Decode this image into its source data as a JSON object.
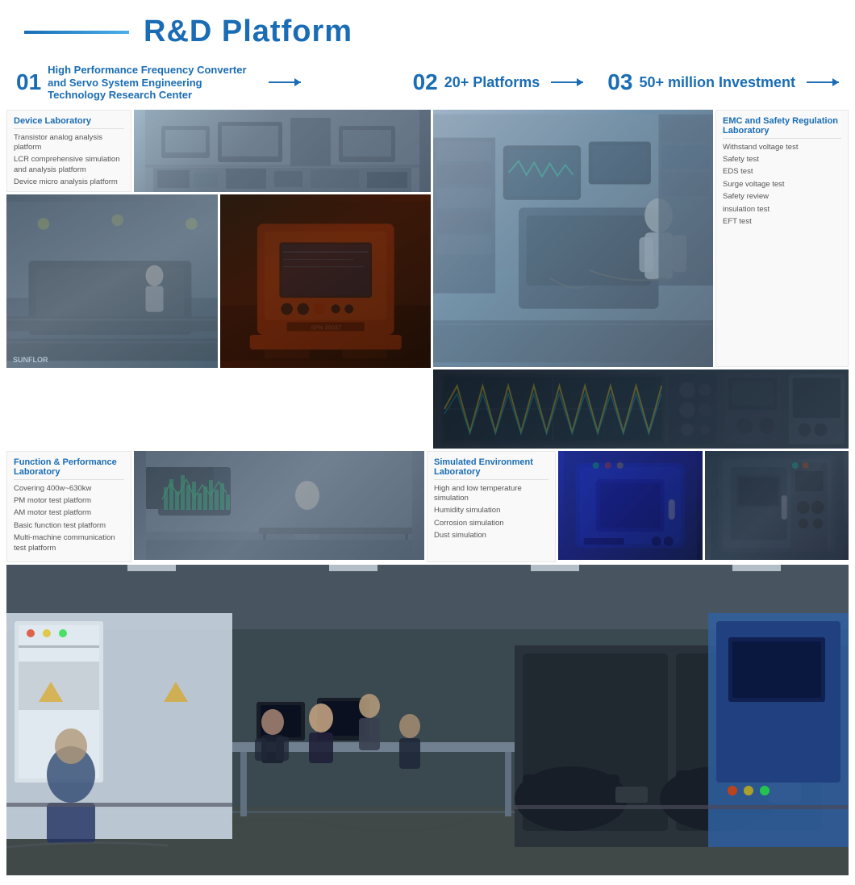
{
  "header": {
    "title": "R&D Platform",
    "line_decoration": true
  },
  "sections": [
    {
      "number": "01",
      "label": "High Performance Frequency Converter and Servo System Engineering Technology Research Center"
    },
    {
      "number": "02",
      "label": "20+ Platforms"
    },
    {
      "number": "03",
      "label": "50+ million Investment"
    }
  ],
  "device_lab": {
    "title": "Device Laboratory",
    "items": [
      "Transistor analog analysis platform",
      "LCR comprehensive simulation and analysis platform",
      "Device micro analysis platform"
    ]
  },
  "emc_lab": {
    "title": "EMC and Safety Regulation Laboratory",
    "items": [
      "Withstand voltage test",
      "Safety test",
      "EDS test",
      "Surge voltage test",
      "Safety review",
      "insulation test",
      "EFT test"
    ]
  },
  "function_lab": {
    "title": "Function & Performance Laboratory",
    "items": [
      "Covering 400w~630kw",
      "PM motor test platform",
      "AM motor test platform",
      "Basic function test platform",
      "Multi-machine communication test platform"
    ]
  },
  "simulated_lab": {
    "title": "Simulated Environment Laboratory",
    "items": [
      "High and low temperature simulation",
      "Humidity simulation",
      "Corrosion simulation",
      "Dust simulation"
    ]
  },
  "images": {
    "device_lab": {
      "alt": "Device laboratory equipment"
    },
    "machine1": {
      "alt": "Manufacturing machine 1"
    },
    "machine2": {
      "alt": "Orange industrial machine"
    },
    "large_top": {
      "alt": "Engineer working at computer station"
    },
    "oscilloscope": {
      "alt": "Oscilloscope waveform display"
    },
    "func_lab": {
      "alt": "Function and performance lab equipment"
    },
    "sim_lab1": {
      "alt": "Blue environmental test chamber 1"
    },
    "sim_lab2": {
      "alt": "Environmental test chamber 2"
    },
    "bottom": {
      "alt": "Large R&D lab with multiple engineers and equipment"
    }
  },
  "colors": {
    "primary": "#1a6db5",
    "accent": "#4ab0e8",
    "bg_panel": "#f9f9f9",
    "border": "#e0e0e0",
    "text_dark": "#333",
    "text_gray": "#666"
  }
}
